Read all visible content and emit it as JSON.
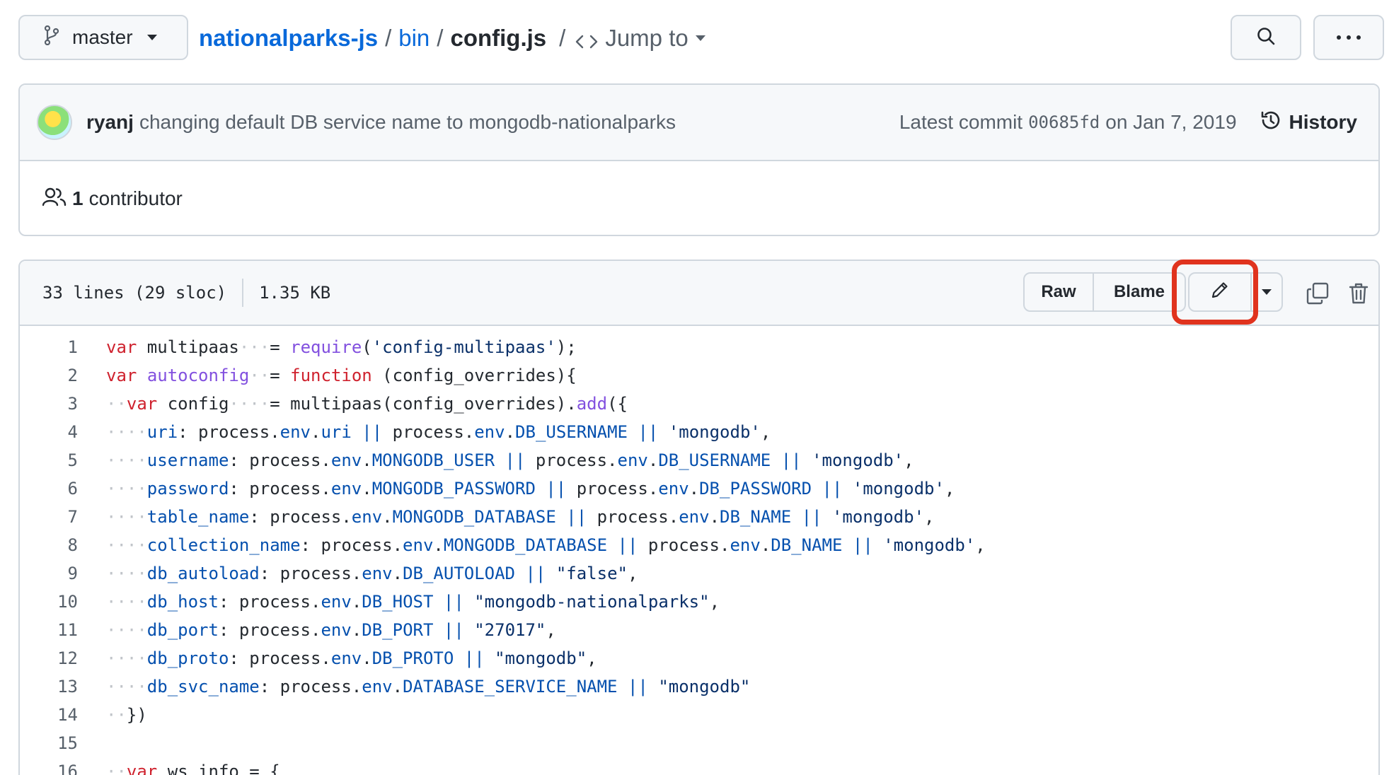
{
  "branch": {
    "label": "master",
    "icon": "git-branch-icon"
  },
  "breadcrumb": {
    "repo": "nationalparks-js",
    "sep1": "/",
    "folder": "bin",
    "sep2": "/",
    "file": "config.js",
    "sep3": "/",
    "jump_label": "Jump to"
  },
  "toolbar": {
    "search_icon": "search-icon",
    "more_icon": "kebab-horizontal-icon"
  },
  "commit": {
    "author": "ryanj",
    "message": "changing default DB service name to mongodb-nationalparks",
    "latest_label": "Latest commit",
    "sha": "00685fd",
    "date_text": "on Jan 7, 2019",
    "history_label": "History"
  },
  "contributors": {
    "count": "1",
    "label": "contributor"
  },
  "file_info": {
    "lines": "33 lines (29 sloc)",
    "size": "1.35 KB"
  },
  "file_actions": {
    "raw": "Raw",
    "blame": "Blame"
  },
  "colors": {
    "link": "#0969da",
    "highlight": "#e0331e",
    "keyword": "#cf222e",
    "function": "#8250df",
    "string": "#0a3069",
    "property": "#0550ae"
  },
  "code_lines": [
    [
      {
        "t": "var",
        "c": "k"
      },
      {
        "t": " multipaas"
      },
      {
        "t": "···",
        "c": "ws"
      },
      {
        "t": "= "
      },
      {
        "t": "require",
        "c": "f"
      },
      {
        "t": "("
      },
      {
        "t": "'config-multipaas'",
        "c": "s"
      },
      {
        "t": ");"
      }
    ],
    [
      {
        "t": "var",
        "c": "k"
      },
      {
        "t": " "
      },
      {
        "t": "autoconfig",
        "c": "f"
      },
      {
        "t": "··",
        "c": "ws"
      },
      {
        "t": "= "
      },
      {
        "t": "function",
        "c": "k"
      },
      {
        "t": " (config_overrides){"
      }
    ],
    [
      {
        "t": "··",
        "c": "ws"
      },
      {
        "t": "var",
        "c": "k"
      },
      {
        "t": " config"
      },
      {
        "t": "····",
        "c": "ws"
      },
      {
        "t": "= multipaas(config_overrides)."
      },
      {
        "t": "add",
        "c": "f"
      },
      {
        "t": "({"
      }
    ],
    [
      {
        "t": "····",
        "c": "ws"
      },
      {
        "t": "uri",
        "c": "p"
      },
      {
        "t": ": process."
      },
      {
        "t": "env",
        "c": "p"
      },
      {
        "t": "."
      },
      {
        "t": "uri",
        "c": "p"
      },
      {
        "t": " "
      },
      {
        "t": "||",
        "c": "p"
      },
      {
        "t": " process."
      },
      {
        "t": "env",
        "c": "p"
      },
      {
        "t": "."
      },
      {
        "t": "DB_USERNAME",
        "c": "p"
      },
      {
        "t": " "
      },
      {
        "t": "||",
        "c": "p"
      },
      {
        "t": " "
      },
      {
        "t": "'mongodb'",
        "c": "s"
      },
      {
        "t": ","
      }
    ],
    [
      {
        "t": "····",
        "c": "ws"
      },
      {
        "t": "username",
        "c": "p"
      },
      {
        "t": ": process."
      },
      {
        "t": "env",
        "c": "p"
      },
      {
        "t": "."
      },
      {
        "t": "MONGODB_USER",
        "c": "p"
      },
      {
        "t": " "
      },
      {
        "t": "||",
        "c": "p"
      },
      {
        "t": " process."
      },
      {
        "t": "env",
        "c": "p"
      },
      {
        "t": "."
      },
      {
        "t": "DB_USERNAME",
        "c": "p"
      },
      {
        "t": " "
      },
      {
        "t": "||",
        "c": "p"
      },
      {
        "t": " "
      },
      {
        "t": "'mongodb'",
        "c": "s"
      },
      {
        "t": ","
      }
    ],
    [
      {
        "t": "····",
        "c": "ws"
      },
      {
        "t": "password",
        "c": "p"
      },
      {
        "t": ": process."
      },
      {
        "t": "env",
        "c": "p"
      },
      {
        "t": "."
      },
      {
        "t": "MONGODB_PASSWORD",
        "c": "p"
      },
      {
        "t": " "
      },
      {
        "t": "||",
        "c": "p"
      },
      {
        "t": " process."
      },
      {
        "t": "env",
        "c": "p"
      },
      {
        "t": "."
      },
      {
        "t": "DB_PASSWORD",
        "c": "p"
      },
      {
        "t": " "
      },
      {
        "t": "||",
        "c": "p"
      },
      {
        "t": " "
      },
      {
        "t": "'mongodb'",
        "c": "s"
      },
      {
        "t": ","
      }
    ],
    [
      {
        "t": "····",
        "c": "ws"
      },
      {
        "t": "table_name",
        "c": "p"
      },
      {
        "t": ": process."
      },
      {
        "t": "env",
        "c": "p"
      },
      {
        "t": "."
      },
      {
        "t": "MONGODB_DATABASE",
        "c": "p"
      },
      {
        "t": " "
      },
      {
        "t": "||",
        "c": "p"
      },
      {
        "t": " process."
      },
      {
        "t": "env",
        "c": "p"
      },
      {
        "t": "."
      },
      {
        "t": "DB_NAME",
        "c": "p"
      },
      {
        "t": " "
      },
      {
        "t": "||",
        "c": "p"
      },
      {
        "t": " "
      },
      {
        "t": "'mongodb'",
        "c": "s"
      },
      {
        "t": ","
      }
    ],
    [
      {
        "t": "····",
        "c": "ws"
      },
      {
        "t": "collection_name",
        "c": "p"
      },
      {
        "t": ": process."
      },
      {
        "t": "env",
        "c": "p"
      },
      {
        "t": "."
      },
      {
        "t": "MONGODB_DATABASE",
        "c": "p"
      },
      {
        "t": " "
      },
      {
        "t": "||",
        "c": "p"
      },
      {
        "t": " process."
      },
      {
        "t": "env",
        "c": "p"
      },
      {
        "t": "."
      },
      {
        "t": "DB_NAME",
        "c": "p"
      },
      {
        "t": " "
      },
      {
        "t": "||",
        "c": "p"
      },
      {
        "t": " "
      },
      {
        "t": "'mongodb'",
        "c": "s"
      },
      {
        "t": ","
      }
    ],
    [
      {
        "t": "····",
        "c": "ws"
      },
      {
        "t": "db_autoload",
        "c": "p"
      },
      {
        "t": ": process."
      },
      {
        "t": "env",
        "c": "p"
      },
      {
        "t": "."
      },
      {
        "t": "DB_AUTOLOAD",
        "c": "p"
      },
      {
        "t": " "
      },
      {
        "t": "||",
        "c": "p"
      },
      {
        "t": " "
      },
      {
        "t": "\"false\"",
        "c": "s"
      },
      {
        "t": ","
      }
    ],
    [
      {
        "t": "····",
        "c": "ws"
      },
      {
        "t": "db_host",
        "c": "p"
      },
      {
        "t": ": process."
      },
      {
        "t": "env",
        "c": "p"
      },
      {
        "t": "."
      },
      {
        "t": "DB_HOST",
        "c": "p"
      },
      {
        "t": " "
      },
      {
        "t": "||",
        "c": "p"
      },
      {
        "t": " "
      },
      {
        "t": "\"mongodb-nationalparks\"",
        "c": "s"
      },
      {
        "t": ","
      }
    ],
    [
      {
        "t": "····",
        "c": "ws"
      },
      {
        "t": "db_port",
        "c": "p"
      },
      {
        "t": ": process."
      },
      {
        "t": "env",
        "c": "p"
      },
      {
        "t": "."
      },
      {
        "t": "DB_PORT",
        "c": "p"
      },
      {
        "t": " "
      },
      {
        "t": "||",
        "c": "p"
      },
      {
        "t": " "
      },
      {
        "t": "\"27017\"",
        "c": "s"
      },
      {
        "t": ","
      }
    ],
    [
      {
        "t": "····",
        "c": "ws"
      },
      {
        "t": "db_proto",
        "c": "p"
      },
      {
        "t": ": process."
      },
      {
        "t": "env",
        "c": "p"
      },
      {
        "t": "."
      },
      {
        "t": "DB_PROTO",
        "c": "p"
      },
      {
        "t": " "
      },
      {
        "t": "||",
        "c": "p"
      },
      {
        "t": " "
      },
      {
        "t": "\"mongodb\"",
        "c": "s"
      },
      {
        "t": ","
      }
    ],
    [
      {
        "t": "····",
        "c": "ws"
      },
      {
        "t": "db_svc_name",
        "c": "p"
      },
      {
        "t": ": process."
      },
      {
        "t": "env",
        "c": "p"
      },
      {
        "t": "."
      },
      {
        "t": "DATABASE_SERVICE_NAME",
        "c": "p"
      },
      {
        "t": " "
      },
      {
        "t": "||",
        "c": "p"
      },
      {
        "t": " "
      },
      {
        "t": "\"mongodb\"",
        "c": "s"
      }
    ],
    [
      {
        "t": "··",
        "c": "ws"
      },
      {
        "t": "})"
      }
    ],
    [],
    [
      {
        "t": "··",
        "c": "ws"
      },
      {
        "t": "var",
        "c": "k"
      },
      {
        "t": " ws_info = {"
      }
    ]
  ]
}
